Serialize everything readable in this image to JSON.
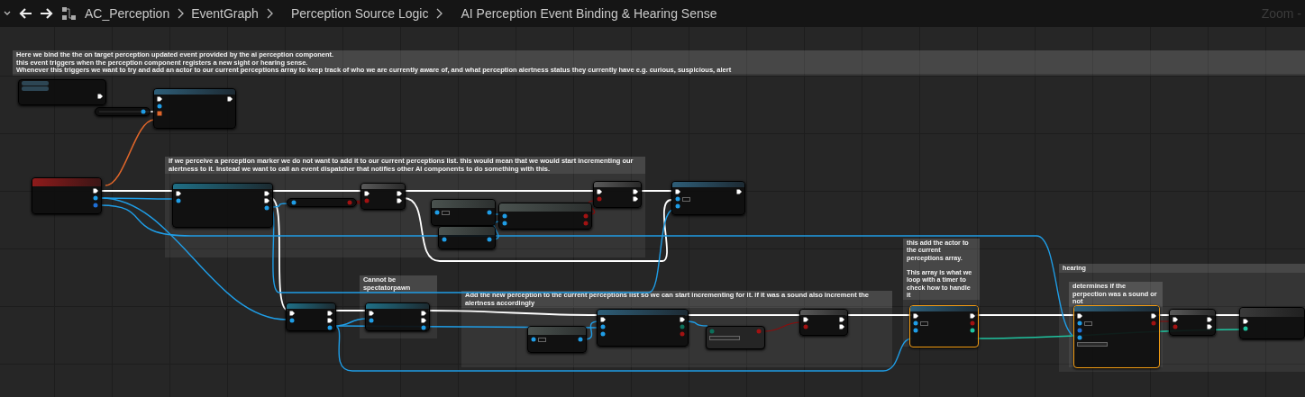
{
  "toolbar": {
    "breadcrumbs": [
      "AC_Perception",
      "EventGraph",
      "Perception Source Logic",
      "AI Perception Event Binding & Hearing Sense"
    ],
    "zoom": "Zoom -"
  },
  "comments": [
    {
      "text": "Here we bind the the on target perception updated event provided by the ai perception component.\nthis event triggers when the perception component registers a new sight or hearing sense.\nWhenever this triggers we want to try and add an actor to our current perceptions array to keep track of who we are currently aware of, and what perception alertness status they currently have e.g. curious, suspicious, alert"
    },
    {
      "text": "If we perceive a perception marker we do not want to add it to our current perceptions list. this would mean that we would start incrementing our alertness to it. Instead we want to call an event dispatcher that notifies other AI components to do something with this."
    },
    {
      "text": "Cannot be spectatorpawn"
    },
    {
      "text": "Add the new perception to the current perceptions list so we can start incrementing for it. if it was a sound also increment the alertness accordingly"
    },
    {
      "text": "this add the actor to the current perceptions array.\n\nThis array is what we loop with a timer to check how to handle it"
    },
    {
      "text": "hearing"
    },
    {
      "text": "determines if the perpection was a sound or not"
    }
  ],
  "nodes": [
    {
      "kind": "tunnel",
      "selected": false,
      "pins_out": [
        {
          "kind": "exec"
        }
      ]
    },
    {
      "kind": "function",
      "selected": false,
      "pins_in": [
        {
          "kind": "exec"
        },
        {
          "kind": "object"
        },
        {
          "kind": "delegate"
        }
      ],
      "pins_out": [
        {
          "kind": "exec"
        }
      ]
    },
    {
      "kind": "getter",
      "selected": false,
      "pins_out": [
        {
          "kind": "object"
        }
      ]
    },
    {
      "kind": "event",
      "selected": false,
      "pins_out": [
        {
          "kind": "exec"
        },
        {
          "kind": "object"
        },
        {
          "kind": "struct"
        }
      ]
    },
    {
      "kind": "cast",
      "selected": false,
      "pins_in": [
        {
          "kind": "exec"
        },
        {
          "kind": "object"
        }
      ],
      "pins_out": [
        {
          "kind": "exec"
        },
        {
          "kind": "exec"
        },
        {
          "kind": "object"
        }
      ]
    },
    {
      "kind": "getter",
      "selected": false,
      "pins_in": [
        {
          "kind": "object"
        }
      ],
      "pins_out": [
        {
          "kind": "bool"
        }
      ]
    },
    {
      "kind": "branch",
      "selected": false,
      "pins_in": [
        {
          "kind": "exec"
        },
        {
          "kind": "bool"
        }
      ],
      "pins_out": [
        {
          "kind": "exec"
        },
        {
          "kind": "exec"
        }
      ]
    },
    {
      "kind": "pure",
      "selected": false,
      "pins_in": [
        {
          "kind": "object-field"
        }
      ],
      "pins_out": [
        {
          "kind": "object"
        }
      ]
    },
    {
      "kind": "pure",
      "selected": false,
      "pins_in": [
        {
          "kind": "object"
        },
        {
          "kind": "object"
        }
      ],
      "pins_out": [
        {
          "kind": "bool"
        },
        {
          "kind": "bool"
        }
      ]
    },
    {
      "kind": "pure",
      "selected": false,
      "pins_in": [
        {
          "kind": "object"
        }
      ],
      "pins_out": [
        {
          "kind": "object"
        }
      ]
    },
    {
      "kind": "branch",
      "selected": false,
      "pins_in": [
        {
          "kind": "exec"
        },
        {
          "kind": "bool"
        }
      ],
      "pins_out": [
        {
          "kind": "exec"
        },
        {
          "kind": "exec"
        }
      ]
    },
    {
      "kind": "function",
      "selected": false,
      "pins_in": [
        {
          "kind": "exec"
        },
        {
          "kind": "object-field"
        },
        {
          "kind": "object"
        }
      ],
      "pins_out": [
        {
          "kind": "exec"
        }
      ]
    },
    {
      "kind": "cast",
      "selected": false,
      "pins_in": [
        {
          "kind": "exec"
        },
        {
          "kind": "object"
        }
      ],
      "pins_out": [
        {
          "kind": "exec"
        },
        {
          "kind": "exec"
        },
        {
          "kind": "object"
        }
      ]
    },
    {
      "kind": "cast",
      "selected": false,
      "pins_in": [
        {
          "kind": "exec"
        },
        {
          "kind": "object"
        }
      ],
      "pins_out": [
        {
          "kind": "exec"
        },
        {
          "kind": "exec"
        },
        {
          "kind": "object"
        }
      ]
    },
    {
      "kind": "pure",
      "selected": false,
      "pins_in": [
        {
          "kind": "object-field"
        }
      ],
      "pins_out": [
        {
          "kind": "object"
        }
      ]
    },
    {
      "kind": "function",
      "selected": false,
      "pins_in": [
        {
          "kind": "exec"
        },
        {
          "kind": "object"
        },
        {
          "kind": "object"
        }
      ],
      "pins_out": [
        {
          "kind": "exec"
        },
        {
          "kind": "enum"
        },
        {
          "kind": "bool"
        }
      ]
    },
    {
      "kind": "compare",
      "selected": false,
      "pins_in": [
        {
          "kind": "enum"
        },
        {
          "kind": "enum-dropdown"
        }
      ],
      "pins_out": [
        {
          "kind": "bool"
        }
      ]
    },
    {
      "kind": "branch",
      "selected": false,
      "pins_in": [
        {
          "kind": "exec"
        },
        {
          "kind": "bool"
        }
      ],
      "pins_out": [
        {
          "kind": "exec"
        },
        {
          "kind": "exec"
        }
      ]
    },
    {
      "kind": "function",
      "selected": true,
      "pins_in": [
        {
          "kind": "exec"
        },
        {
          "kind": "object-field"
        },
        {
          "kind": "object"
        }
      ],
      "pins_out": [
        {
          "kind": "exec"
        },
        {
          "kind": "bool"
        },
        {
          "kind": "int"
        }
      ]
    },
    {
      "kind": "function",
      "selected": true,
      "pins_in": [
        {
          "kind": "exec"
        },
        {
          "kind": "object-field"
        },
        {
          "kind": "struct"
        },
        {
          "kind": "object"
        },
        {
          "kind": "enum-dropdown"
        }
      ],
      "pins_out": [
        {
          "kind": "exec"
        },
        {
          "kind": "bool"
        }
      ]
    },
    {
      "kind": "branch",
      "selected": false,
      "pins_in": [
        {
          "kind": "exec"
        },
        {
          "kind": "bool"
        }
      ],
      "pins_out": [
        {
          "kind": "exec"
        },
        {
          "kind": "exec"
        }
      ]
    },
    {
      "kind": "collapsed",
      "selected": false,
      "pins_in": [
        {
          "kind": "exec"
        },
        {
          "kind": "int"
        }
      ]
    }
  ]
}
